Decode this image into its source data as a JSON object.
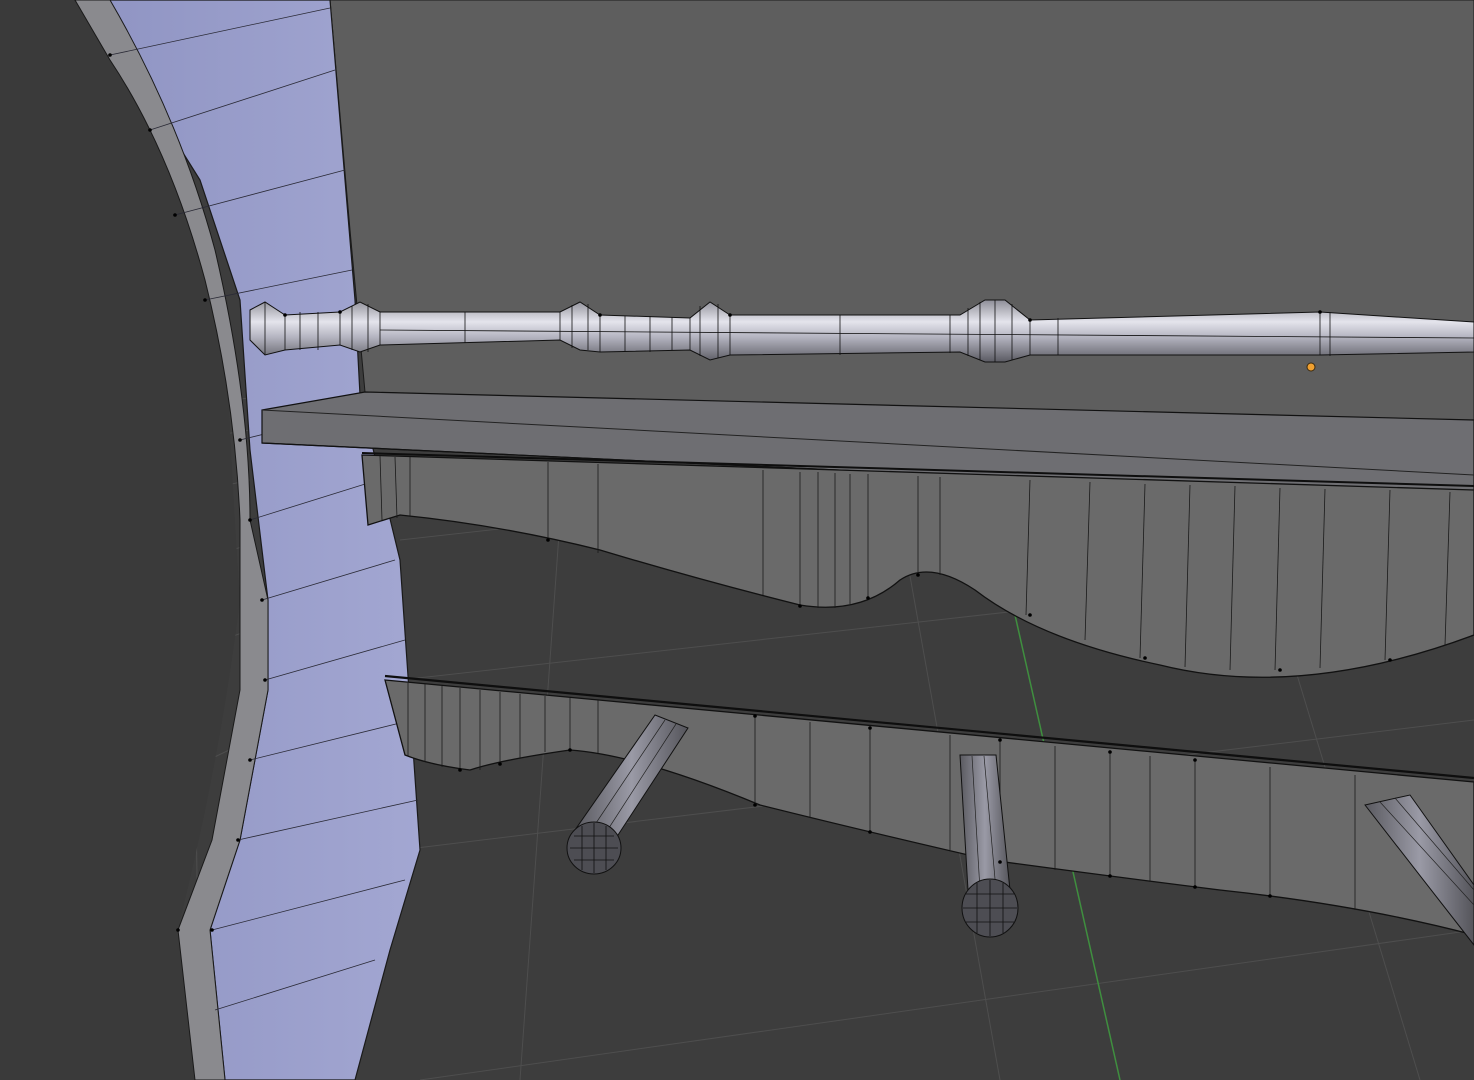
{
  "viewport": {
    "view": "3d-viewport",
    "mode": "edit-mode",
    "shading": "solid",
    "show_wireframe_overlay": true,
    "grid_floor": true
  },
  "colors": {
    "background": "#3d3d3d",
    "grid_line": "#4e4e4e",
    "x_axis": "#8c3a3a",
    "y_axis": "#3f8f3f",
    "mesh_face_back": "#5e5e5e",
    "mesh_face_lit": "#9b9fc8",
    "mesh_face_gray": "#6b6b6b",
    "edge": "#111111",
    "vertex": "#000000",
    "object_origin": "#f0a030"
  },
  "scene": {
    "objects": [
      "curved-side-panel",
      "back-board",
      "turned-spindle-rail",
      "shelf-top",
      "apron-upper",
      "apron-lower",
      "leg-left",
      "leg-middle",
      "leg-right"
    ]
  }
}
